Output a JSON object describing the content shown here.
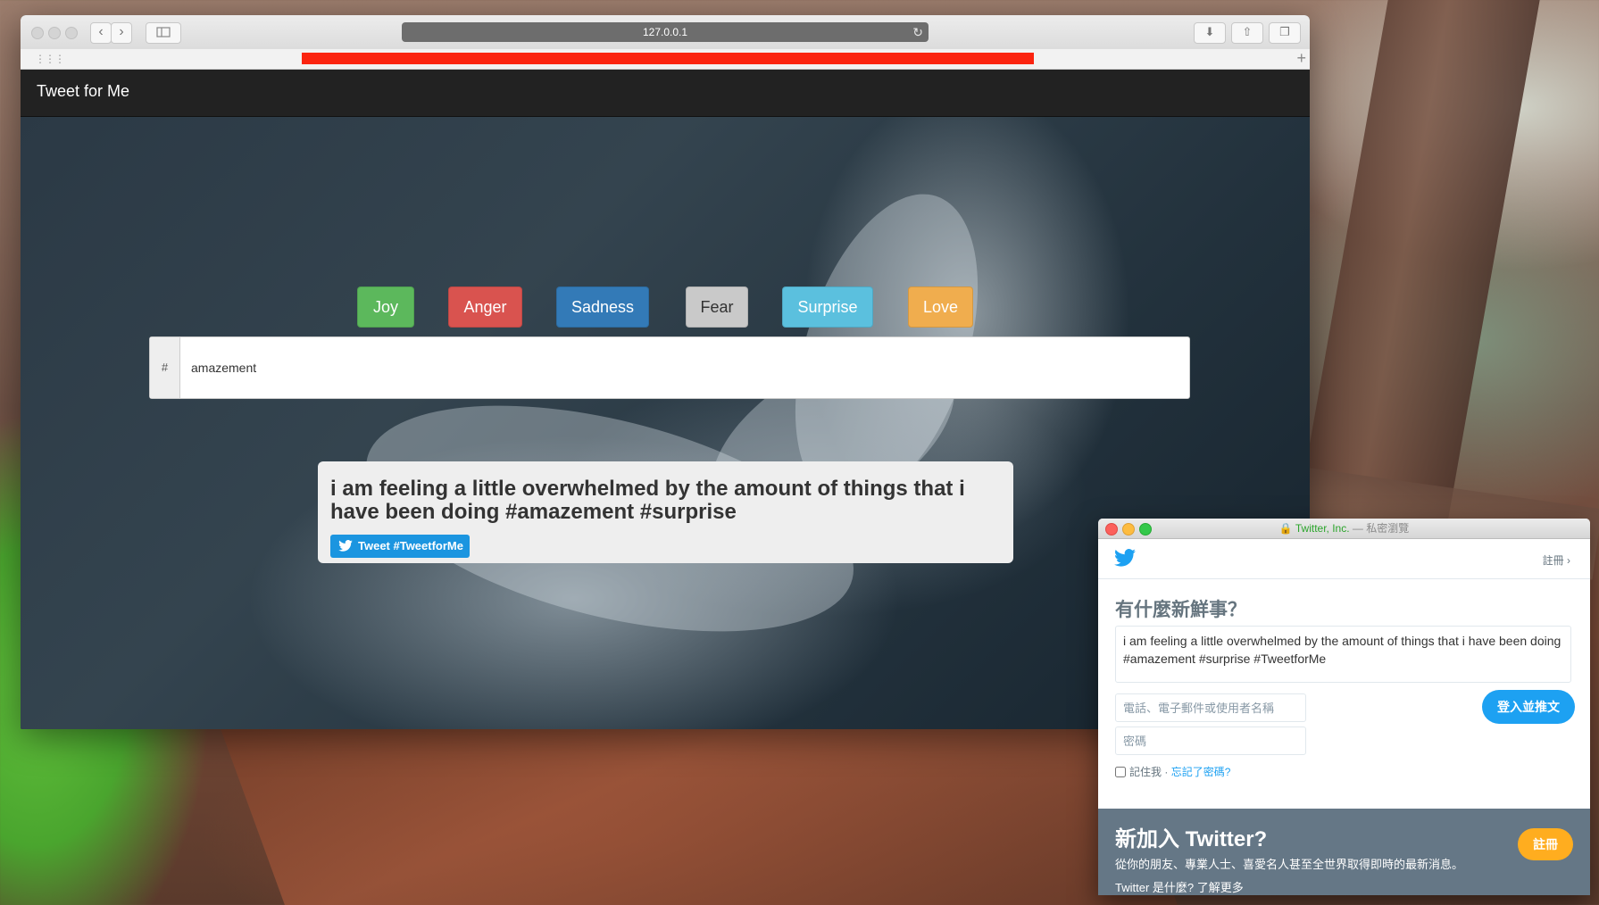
{
  "browser": {
    "url": "127.0.0.1",
    "back_icon": "chevron-left-icon",
    "forward_icon": "chevron-right-icon",
    "sidebar_icon": "sidebar-icon",
    "reload_icon": "reload-icon",
    "download_icon": "download-icon",
    "share_icon": "share-icon",
    "tabs_icon": "tabs-icon",
    "new_tab_icon": "plus-icon",
    "loading_color": "#fb2410"
  },
  "app": {
    "brand": "Tweet for Me",
    "emotions": [
      {
        "label": "Joy",
        "color": "#5cb85c"
      },
      {
        "label": "Anger",
        "color": "#d9534f"
      },
      {
        "label": "Sadness",
        "color": "#337ab7"
      },
      {
        "label": "Fear",
        "color": "#c9c9c9"
      },
      {
        "label": "Surprise",
        "color": "#5bc0de"
      },
      {
        "label": "Love",
        "color": "#f0ad4e"
      }
    ],
    "hashtag_prefix": "#",
    "hashtag_value": "amazement",
    "tweet_text": "i am feeling a little overwhelmed by the amount of things that i have been doing #amazement #surprise",
    "tweet_button": "Tweet #TweetforMe"
  },
  "popup": {
    "title_org": "Twitter, Inc.",
    "title_sub": " — 私密瀏覽",
    "signup_link": "註冊 ›",
    "heading": "有什麼新鮮事？",
    "status_text": "i am feeling a little overwhelmed by the amount of things that i have been doing  #amazement #surprise #TweetforMe",
    "username_placeholder": "電話、電子郵件或使用者名稱",
    "password_placeholder": "密碼",
    "login_button": "登入並推文",
    "remember_label": "記住我",
    "separator": " · ",
    "forgot_link": "忘記了密碼?",
    "new_heading": "新加入 Twitter?",
    "new_desc": "從你的朋友、專業人士、喜愛名人甚至全世界取得即時的最新消息。",
    "new_more": "Twitter 是什麼? 了解更多",
    "register_button": "註冊",
    "brand_color": "#1da1f2"
  }
}
